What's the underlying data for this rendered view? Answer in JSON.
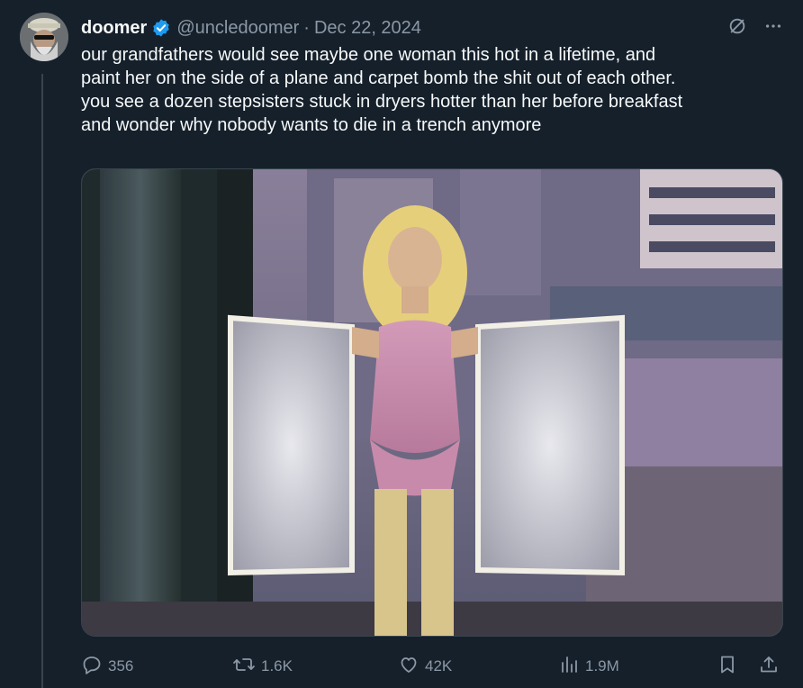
{
  "post": {
    "display_name": "doomer",
    "handle": "@uncledoomer",
    "separator": "·",
    "date": "Dec 22, 2024",
    "text_lines": [
      "our grandfathers would see maybe one woman this hot in a lifetime, and",
      "paint her on the side of a plane and carpet bomb the shit out of each other.",
      "you see a dozen stepsisters stuck in dryers hotter than her before breakfast",
      "and wonder why nobody wants to die in a trench anymore"
    ]
  },
  "header_icons": [
    "grok-slash-icon",
    "more-dots-icon"
  ],
  "stats": {
    "replies": "356",
    "reposts": "1.6K",
    "likes": "42K",
    "views": "1.9M"
  },
  "colors": {
    "background": "#15202b",
    "text": "#f7f9f9",
    "muted": "#8b98a5",
    "verified": "#1d9bf0",
    "divider": "#38444d"
  }
}
